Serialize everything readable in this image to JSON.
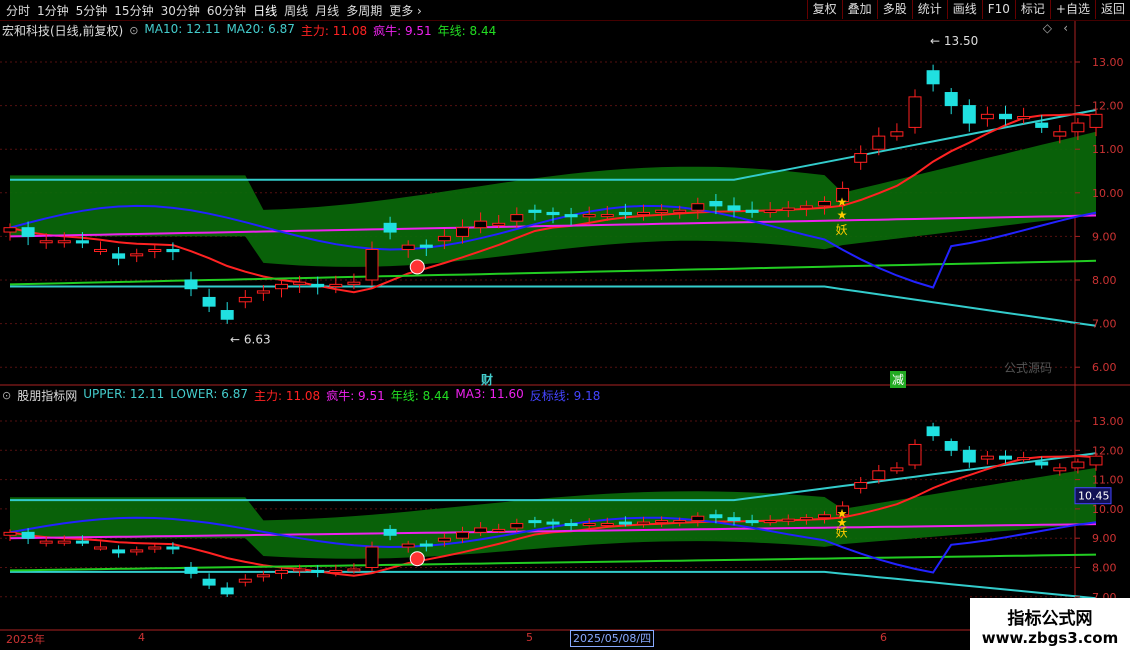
{
  "toolbar": {
    "left": [
      "分时",
      "1分钟",
      "5分钟",
      "15分钟",
      "30分钟",
      "60分钟",
      "日线",
      "周线",
      "月线",
      "多周期",
      "更多"
    ],
    "active": "日线",
    "right": [
      "复权",
      "叠加",
      "多股",
      "统计",
      "画线",
      "F10",
      "标记",
      "+自选",
      "返回"
    ]
  },
  "panel1": {
    "stock": "宏和科技(日线,前复权)",
    "items": [
      {
        "label": "MA10: 12.11",
        "color": "#4cc"
      },
      {
        "label": "MA20: 6.87",
        "color": "#4cc"
      },
      {
        "label": "主力: 11.08",
        "color": "#f22"
      },
      {
        "label": "疯牛: 9.51",
        "color": "#e2e"
      },
      {
        "label": "年线: 8.44",
        "color": "#2d2"
      }
    ],
    "y_ticks": [
      "13.00",
      "12.00",
      "11.00",
      "10.00",
      "9.00",
      "8.00",
      "7.00",
      "6.00"
    ],
    "high_label": "13.50",
    "low_label": "6.63",
    "marker_cai": "财",
    "marker_jian": "减",
    "yao": "妖",
    "formula_src": "公式源码"
  },
  "panel2": {
    "title": "股朋指标网",
    "items": [
      {
        "label": "UPPER: 12.11",
        "color": "#4cc"
      },
      {
        "label": "LOWER: 6.87",
        "color": "#4cc"
      },
      {
        "label": "主力: 11.08",
        "color": "#f22"
      },
      {
        "label": "疯牛: 9.51",
        "color": "#e2e"
      },
      {
        "label": "年线: 8.44",
        "color": "#2d2"
      },
      {
        "label": "MA3: 11.60",
        "color": "#e2e"
      },
      {
        "label": "反标线: 9.18",
        "color": "#44f"
      }
    ],
    "y_ticks": [
      "13.00",
      "12.00",
      "11.00",
      "10.00",
      "9.00",
      "8.00",
      "7.00"
    ],
    "price_box": "10.45",
    "yao": "妖"
  },
  "datebar": {
    "year": "2025年",
    "m4": "4",
    "m5": "5",
    "selected": "2025/05/08/四",
    "m6": "6"
  },
  "watermark": {
    "line1": "指标公式网",
    "line2": "www.zbgs3.com"
  },
  "colors": {
    "up": "#ff2020",
    "down": "#20e0e0",
    "band": "#0a6b0a",
    "grid": "#551111"
  }
}
